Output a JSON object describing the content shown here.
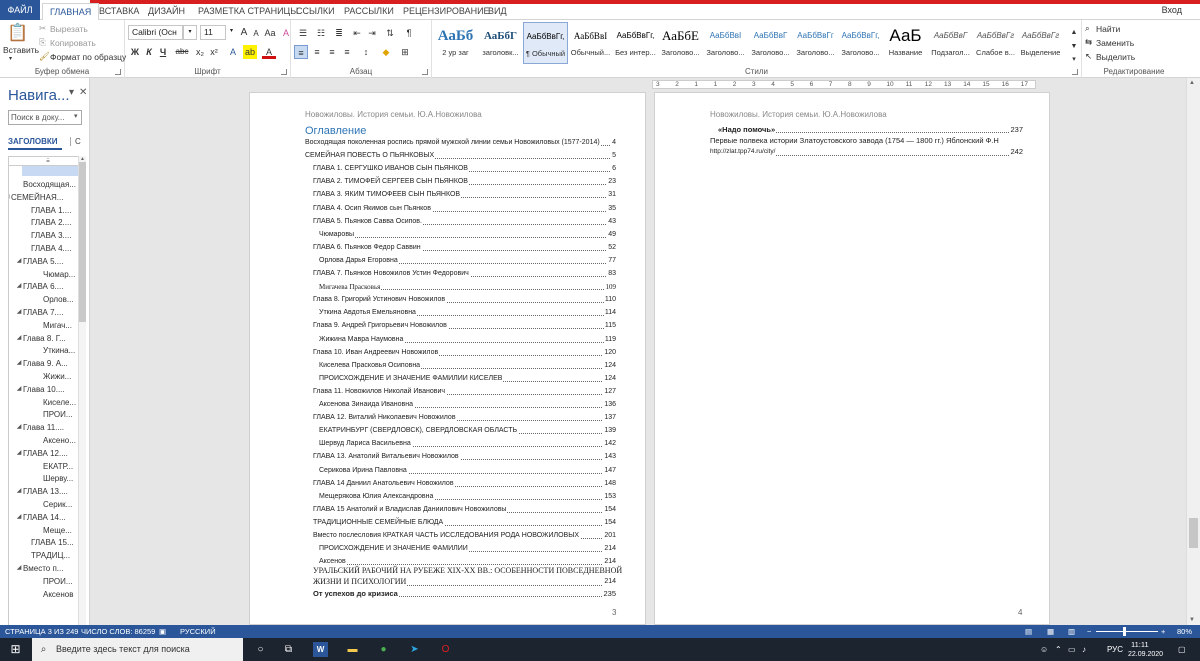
{
  "ribbon_tabs": [
    "ФАЙЛ",
    "ГЛАВНАЯ",
    "ВСТАВКА",
    "ДИЗАЙН",
    "РАЗМЕТКА СТРАНИЦЫ",
    "ССЫЛКИ",
    "РАССЫЛКИ",
    "РЕЦЕНЗИРОВАНИЕ",
    "ВИД"
  ],
  "signin": "Вход",
  "clipboard": {
    "paste": "Вставить",
    "cut": "Вырезать",
    "copy": "Копировать",
    "format_painter": "Формат по образцу",
    "label": "Буфер обмена"
  },
  "font": {
    "name": "Calibri (Осн",
    "size": "11",
    "bold": "Ж",
    "italic": "К",
    "underline": "Ч",
    "strike": "abc",
    "sub": "x₂",
    "sup": "x²",
    "grow": "A",
    "shrink": "A",
    "case": "Aa",
    "clear": "A",
    "effects": "A",
    "highlight": "ab",
    "color": "A",
    "label": "Шрифт"
  },
  "paragraph": {
    "pilcrow": "¶",
    "label": "Абзац"
  },
  "styles": {
    "label": "Стили",
    "items": [
      {
        "preview": "АаБб",
        "name": "2 ур заг"
      },
      {
        "preview": "АаБбГ",
        "name": "заголовк..."
      },
      {
        "preview": "АаБбВвГг,",
        "name": "¶ Обычный"
      },
      {
        "preview": "АаБбВвІ",
        "name": "Обычный..."
      },
      {
        "preview": "АаБбВвГг,",
        "name": "Без интер..."
      },
      {
        "preview": "АаБбЕ",
        "name": "Заголово..."
      },
      {
        "preview": "АаБбВвІ",
        "name": "Заголово..."
      },
      {
        "preview": "АаБбВвГ",
        "name": "Заголово..."
      },
      {
        "preview": "АаБбВвГг",
        "name": "Заголово..."
      },
      {
        "preview": "АаБбВвГг,",
        "name": "Заголово..."
      },
      {
        "preview": "АаБ",
        "name": "Название"
      },
      {
        "preview": "АаБбВвГ",
        "name": "Подзагол..."
      },
      {
        "preview": "АаБбВвГг",
        "name": "Слабое в..."
      },
      {
        "preview": "АаБбВвГг",
        "name": "Выделение"
      }
    ]
  },
  "editing": {
    "find": "Найти",
    "replace": "Заменить",
    "select": "Выделить",
    "label": "Редактирование"
  },
  "nav": {
    "title": "Навига...",
    "search_placeholder": "Поиск в доку...",
    "tab": "ЗАГОЛОВКИ",
    "tab2": "С",
    "items": [
      {
        "t": "Восходящая...",
        "l": 1,
        "tw": ""
      },
      {
        "t": "СЕМЕЙНАЯ...",
        "l": 0,
        "tw": "◢"
      },
      {
        "t": "ГЛАВА 1....",
        "l": 2,
        "tw": ""
      },
      {
        "t": "ГЛАВА 2....",
        "l": 2,
        "tw": ""
      },
      {
        "t": "ГЛАВА 3....",
        "l": 2,
        "tw": ""
      },
      {
        "t": "ГЛАВА 4....",
        "l": 2,
        "tw": ""
      },
      {
        "t": "ГЛАВА 5....",
        "l": 1,
        "tw": "◢"
      },
      {
        "t": "Чюмар...",
        "l": 3,
        "tw": ""
      },
      {
        "t": "ГЛАВА 6....",
        "l": 1,
        "tw": "◢"
      },
      {
        "t": "Орлов...",
        "l": 3,
        "tw": ""
      },
      {
        "t": "ГЛАВА 7....",
        "l": 1,
        "tw": "◢"
      },
      {
        "t": "Мигач...",
        "l": 3,
        "tw": ""
      },
      {
        "t": "Глава 8. Г...",
        "l": 1,
        "tw": "◢"
      },
      {
        "t": "Уткина...",
        "l": 3,
        "tw": ""
      },
      {
        "t": "Глава 9. А...",
        "l": 1,
        "tw": "◢"
      },
      {
        "t": "Жижи...",
        "l": 3,
        "tw": ""
      },
      {
        "t": "Глава 10....",
        "l": 1,
        "tw": "◢"
      },
      {
        "t": "Киселе...",
        "l": 3,
        "tw": ""
      },
      {
        "t": "ПРОИ...",
        "l": 3,
        "tw": ""
      },
      {
        "t": "Глава 11....",
        "l": 1,
        "tw": "◢"
      },
      {
        "t": "Аксено...",
        "l": 3,
        "tw": ""
      },
      {
        "t": "ГЛАВА 12....",
        "l": 1,
        "tw": "◢"
      },
      {
        "t": "ЕКАТР...",
        "l": 3,
        "tw": ""
      },
      {
        "t": "Шерву...",
        "l": 3,
        "tw": ""
      },
      {
        "t": "ГЛАВА 13....",
        "l": 1,
        "tw": "◢"
      },
      {
        "t": "Серик...",
        "l": 3,
        "tw": ""
      },
      {
        "t": "ГЛАВА 14...",
        "l": 1,
        "tw": "◢"
      },
      {
        "t": "Меще...",
        "l": 3,
        "tw": ""
      },
      {
        "t": "ГЛАВА 15...",
        "l": 2,
        "tw": ""
      },
      {
        "t": "ТРАДИЦ...",
        "l": 2,
        "tw": ""
      },
      {
        "t": "Вместо п...",
        "l": 1,
        "tw": "◢"
      },
      {
        "t": "ПРОИ...",
        "l": 3,
        "tw": ""
      },
      {
        "t": "Аксенов",
        "l": 3,
        "tw": ""
      }
    ]
  },
  "ruler_ticks": [
    "3",
    "2",
    "1",
    "1",
    "2",
    "3",
    "4",
    "5",
    "6",
    "7",
    "8",
    "9",
    "10",
    "11",
    "12",
    "13",
    "14",
    "15",
    "16",
    "17"
  ],
  "page3": {
    "header": "Новожиловы. История семьи. Ю.А.Новожилова",
    "toc_title": "Оглавление",
    "page_number": "3",
    "entries": [
      {
        "t": "Восходящая поколенная роспись прямой мужской линии семьи Новожиловых (1577-2014)",
        "p": "4",
        "i": 0
      },
      {
        "t": "СЕМЕЙНАЯ ПОВЕСТЬ О ПЬЯНКОВЫХ",
        "p": "5",
        "i": 0
      },
      {
        "t": "ГЛАВА 1. СЕРГУШКО ИВАНОВ СЫН ПЬЯНКОВ",
        "p": "6",
        "i": 1
      },
      {
        "t": "ГЛАВА 2. ТИМОФЕЙ СЕРГЕЕВ СЫН ПЬЯНКОВ",
        "p": "23",
        "i": 1
      },
      {
        "t": "ГЛАВА 3. ЯКИМ ТИМОФЕЕВ СЫН ПЬЯНКОВ",
        "p": "31",
        "i": 1
      },
      {
        "t": "ГЛАВА 4. Осип Якимов сын Пьянков",
        "p": "35",
        "i": 1
      },
      {
        "t": "ГЛАВА 5. Пьянков Савва Осипов.",
        "p": "43",
        "i": 1
      },
      {
        "t": "Чюмаровы",
        "p": "49",
        "i": 2
      },
      {
        "t": "ГЛАВА 6. Пьянков Федор Саввин",
        "p": "52",
        "i": 1
      },
      {
        "t": "Орлова Дарья Егоровна",
        "p": "77",
        "i": 2
      },
      {
        "t": "ГЛАВА 7. Пьянков Новожилов Устин Федорович",
        "p": "83",
        "i": 1
      },
      {
        "t": "Мигачева Прасковья",
        "p": "109",
        "i": 2
      },
      {
        "t": "Глава 8. Григорий Устинович Новожилов",
        "p": "110",
        "i": 1
      },
      {
        "t": "Уткина Авдотья Емельяновна",
        "p": "114",
        "i": 2
      },
      {
        "t": "Глава 9. Андрей Григорьевич Новожилов",
        "p": "115",
        "i": 1
      },
      {
        "t": "Жижина Мавра Наумовна",
        "p": "119",
        "i": 2
      },
      {
        "t": "Глава 10. Иван Андреевич Новожилов",
        "p": "120",
        "i": 1
      },
      {
        "t": "Киселева Прасковья Осиповна",
        "p": "124",
        "i": 2
      },
      {
        "t": "ПРОИСХОЖДЕНИЕ И ЗНАЧЕНИЕ ФАМИЛИИ КИСЕЛЕВ",
        "p": "124",
        "i": 2
      },
      {
        "t": "Глава 11. Новожилов Николай Иванович",
        "p": "127",
        "i": 1
      },
      {
        "t": "Аксенова Зинаида Ивановна",
        "p": "136",
        "i": 2
      },
      {
        "t": "ГЛАВА 12. Виталий Николаевич Новожилов",
        "p": "137",
        "i": 1
      },
      {
        "t": "ЕКАТРИНБУРГ (СВЕРДЛОВСК), СВЕРДЛОВСКАЯ ОБЛАСТЬ",
        "p": "139",
        "i": 2
      },
      {
        "t": "Шервуд Лариса Васильевна",
        "p": "142",
        "i": 2
      },
      {
        "t": "ГЛАВА 13. Анатолий Витальевич Новожилов",
        "p": "143",
        "i": 1
      },
      {
        "t": "Серикова Ирина Павловна",
        "p": "147",
        "i": 2
      },
      {
        "t": "ГЛАВА 14 Даниил Анатольевич Новожилов",
        "p": "148",
        "i": 1
      },
      {
        "t": "Мещерякова Юлия Александровна",
        "p": "153",
        "i": 2
      },
      {
        "t": "ГЛАВА 15 Анатолий и Владислав Даниилович Новожиловы",
        "p": "154",
        "i": 1
      },
      {
        "t": "ТРАДИЦИОННЫЕ СЕМЕЙНЫЕ БЛЮДА",
        "p": "154",
        "i": 1
      },
      {
        "t": "Вместо послесловия КРАТКАЯ ЧАСТЬ ИССЛЕДОВАНИЯ РОДА НОВОЖИЛОВЫХ",
        "p": "201",
        "i": 1
      },
      {
        "t": "ПРОИСХОЖДЕНИЕ И ЗНАЧЕНИЕ ФАМИЛИИ",
        "p": "214",
        "i": 2
      },
      {
        "t": "Аксенов",
        "p": "214",
        "i": 2
      }
    ],
    "special": [
      {
        "line1": "УРАЛЬСКИЙ РАБОЧИЙ НА РУБЕЖЕ XIX-XX ВВ.: ОСОБЕННОСТИ ПОВСЕДНЕВНОЙ",
        "line2": "ЖИЗНИ И ПСИХОЛОГИИ",
        "p": "214"
      },
      {
        "t": "От успехов до кризиса",
        "p": "235"
      }
    ]
  },
  "page4": {
    "header": "Новожиловы. История семьи. Ю.А.Новожилова",
    "page_number": "4",
    "entries": [
      {
        "t": "«Надо помочь»",
        "p": "237"
      },
      {
        "t": "Первые полвека истории Златоустовского завода (1754 — 1800 гг.) Яблонский Ф.Н",
        "t2": "http://zlat.tpp74.ru/city/",
        "p": "242"
      }
    ]
  },
  "status": {
    "page": "СТРАНИЦА 3 ИЗ 249",
    "words": "ЧИСЛО СЛОВ: 86259",
    "lang": "РУССКИЙ",
    "zoom": "80%"
  },
  "taskbar": {
    "search": "Введите здесь текст для поиска",
    "lang": "РУС",
    "time": "11:11",
    "date": "22.09.2020"
  },
  "colors": {
    "accent": "#2b579a",
    "heading": "#2e74b5"
  }
}
